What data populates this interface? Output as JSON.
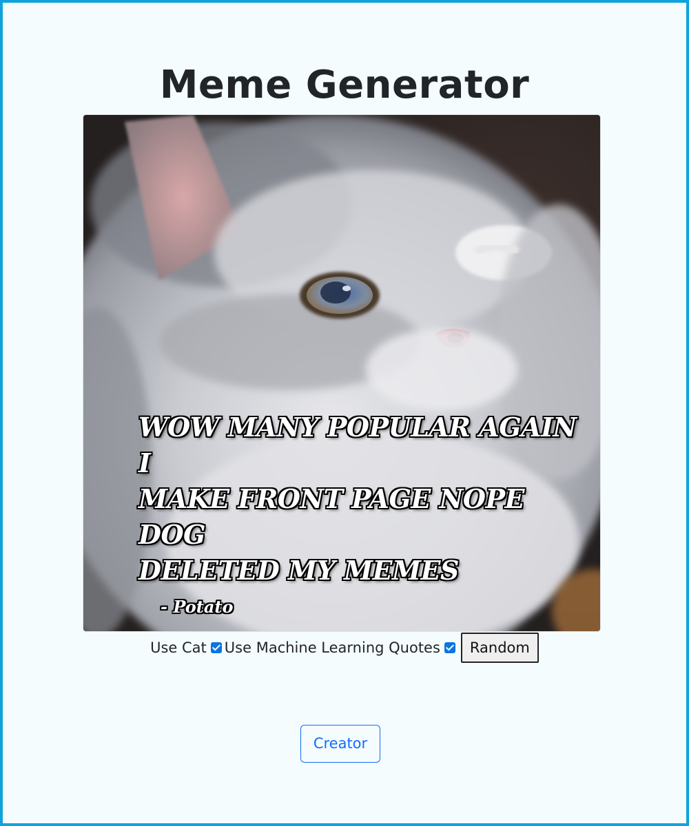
{
  "header": {
    "title": "Meme Generator"
  },
  "meme": {
    "image_subject": "grey persian cat",
    "quote_lines": [
      "WOW MANY POPULAR AGAIN I",
      "MAKE FRONT PAGE NOPE DOG",
      "DELETED MY MEMES"
    ],
    "author": "- Potato"
  },
  "controls": {
    "use_cat_label": "Use Cat",
    "use_cat_checked": true,
    "use_ml_label": "Use Machine Learning Quotes",
    "use_ml_checked": true,
    "random_label": "Random"
  },
  "footer": {
    "creator_label": "Creator"
  },
  "colors": {
    "border": "#10a2dc",
    "background": "#f5fcfd",
    "accent": "#0d6efd",
    "checkbox": "#0a75e3"
  }
}
